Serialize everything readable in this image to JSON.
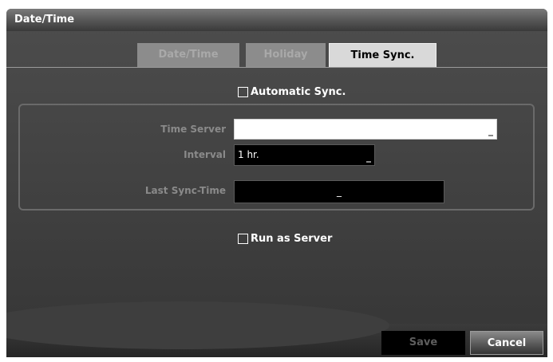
{
  "window": {
    "title": "Date/Time"
  },
  "tabs": [
    {
      "label": "Date/Time",
      "active": false
    },
    {
      "label": "Holiday",
      "active": false
    },
    {
      "label": "Time Sync.",
      "active": true
    }
  ],
  "automatic_sync": {
    "label": "Automatic Sync.",
    "checked": false
  },
  "time_server": {
    "label": "Time Server",
    "value": ""
  },
  "interval": {
    "label": "Interval",
    "value": "1 hr."
  },
  "last_sync": {
    "label": "Last Sync-Time",
    "value": "_"
  },
  "run_as_server": {
    "label": "Run as Server",
    "checked": false
  },
  "buttons": {
    "save": "Save",
    "cancel": "Cancel"
  },
  "colors": {
    "panel": "#404040",
    "active_tab": "#d9d9d9",
    "inactive_tab": "#8c8c8c",
    "label": "#8a8a8a"
  }
}
